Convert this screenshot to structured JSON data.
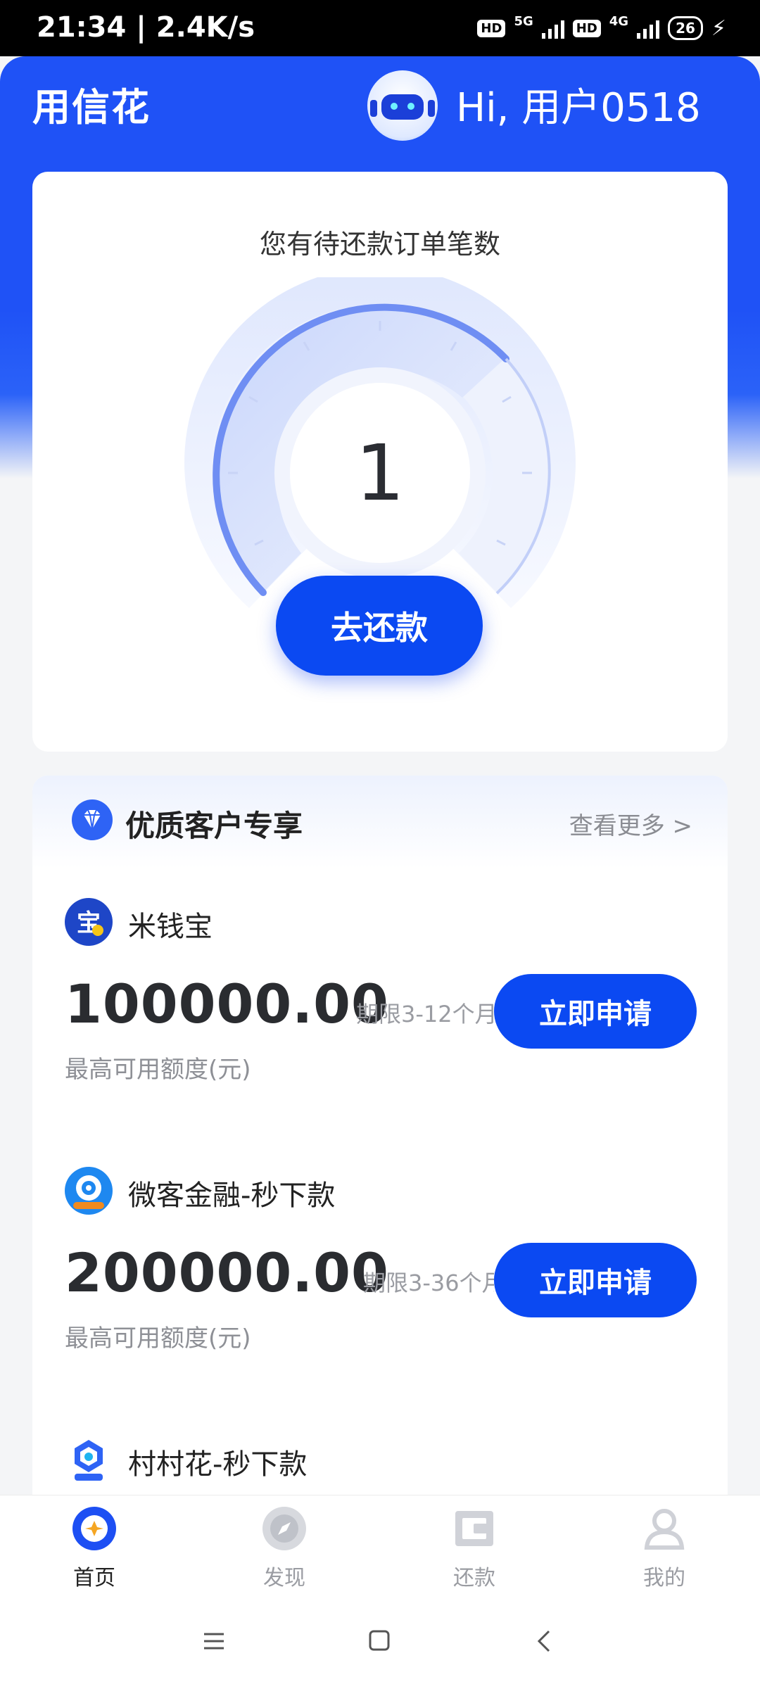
{
  "status_bar": {
    "time": "21:34 | 2.4K/s",
    "hd1": "HD",
    "net1": "5G",
    "hd2": "HD",
    "net2": "4G",
    "battery": "26"
  },
  "header": {
    "brand": "用信花",
    "greeting": "Hi, 用户0518"
  },
  "repayment_card": {
    "title": "您有待还款订单笔数",
    "count": "1",
    "button": "去还款"
  },
  "section": {
    "title": "优质客户专享",
    "more": "查看更多 >"
  },
  "products": [
    {
      "name": "米钱宝",
      "amount": "100000.00",
      "term": "期限3-12个月",
      "label": "最高可用额度(元)",
      "button": "立即申请"
    },
    {
      "name": "微客金融-秒下款",
      "amount": "200000.00",
      "term": "期限3-36个月",
      "label": "最高可用额度(元)",
      "button": "立即申请"
    },
    {
      "name": "村村花-秒下款"
    }
  ],
  "tabs": [
    {
      "label": "首页",
      "icon": "home-icon",
      "active": true
    },
    {
      "label": "发现",
      "icon": "compass-icon",
      "active": false
    },
    {
      "label": "还款",
      "icon": "wallet-icon",
      "active": false
    },
    {
      "label": "我的",
      "icon": "user-icon",
      "active": false
    }
  ],
  "colors": {
    "brand_blue": "#1f52f6",
    "button_blue": "#0b49f2"
  }
}
